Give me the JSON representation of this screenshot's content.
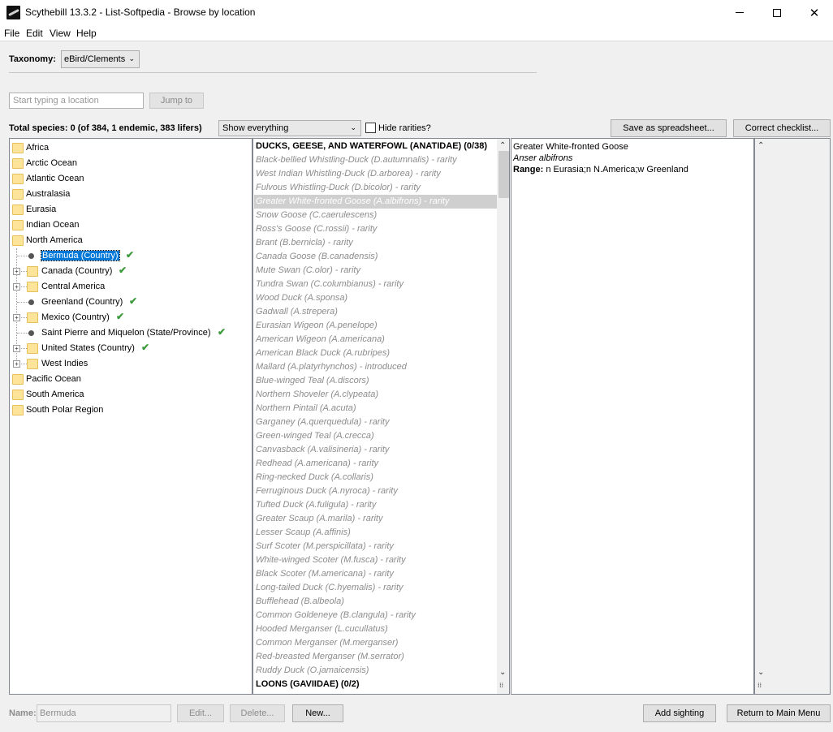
{
  "window": {
    "title": "Scythebill 13.3.2 - List-Softpedia - Browse by location",
    "icon": "scythebill-logo-icon",
    "minimize": "minimize",
    "maximize": "maximize",
    "close_glyph": "✕"
  },
  "menu": [
    "File",
    "Edit",
    "View",
    "Help"
  ],
  "taxonomy": {
    "label": "Taxonomy:",
    "value": "eBird/Clements"
  },
  "location_search": {
    "placeholder": "Start typing a location",
    "jump_label": "Jump to"
  },
  "totals": {
    "text": "Total species: 0 (of 384, 1 endemic, 383 lifers)",
    "filter_value": "Show everything",
    "hide_rarities_label": "Hide rarities?",
    "hide_rarities_checked": false,
    "save_label": "Save as spreadsheet...",
    "correct_label": "Correct checklist..."
  },
  "tree": {
    "top_level": [
      "Africa",
      "Arctic Ocean",
      "Atlantic Ocean",
      "Australasia",
      "Eurasia",
      "Indian Ocean",
      "North America",
      "Pacific Ocean",
      "South America",
      "South Polar Region"
    ],
    "north_america_children": [
      {
        "label": "Bermuda (Country)",
        "kind": "leaf",
        "checked": true,
        "selected": true
      },
      {
        "label": "Canada (Country)",
        "kind": "folder",
        "checked": true,
        "selected": false
      },
      {
        "label": "Central America",
        "kind": "folder",
        "checked": false,
        "selected": false
      },
      {
        "label": "Greenland (Country)",
        "kind": "leaf",
        "checked": true,
        "selected": false
      },
      {
        "label": "Mexico (Country)",
        "kind": "folder",
        "checked": true,
        "selected": false
      },
      {
        "label": "Saint Pierre and Miquelon (State/Province)",
        "kind": "leaf",
        "checked": true,
        "selected": false
      },
      {
        "label": "United States (Country)",
        "kind": "folder",
        "checked": true,
        "selected": false
      },
      {
        "label": "West Indies",
        "kind": "folder",
        "checked": false,
        "selected": false
      }
    ],
    "check_glyph": "✔",
    "expander_glyph": "+"
  },
  "species": {
    "family_1": "DUCKS, GEESE, AND WATERFOWL (ANATIDAE) (0/38)",
    "family_2": "LOONS (GAVIIDAE) (0/2)",
    "rows": [
      "Black-bellied Whistling-Duck (D.autumnalis) - rarity",
      "West Indian Whistling-Duck (D.arborea) - rarity",
      "Fulvous Whistling-Duck (D.bicolor) - rarity",
      "Greater White-fronted Goose (A.albifrons) - rarity",
      "Snow Goose (C.caerulescens)",
      "Ross's Goose (C.rossii) - rarity",
      "Brant (B.bernicla) - rarity",
      "Canada Goose (B.canadensis)",
      "Mute Swan (C.olor) - rarity",
      "Tundra Swan (C.columbianus) - rarity",
      "Wood Duck (A.sponsa)",
      "Gadwall (A.strepera)",
      "Eurasian Wigeon (A.penelope)",
      "American Wigeon (A.americana)",
      "American Black Duck (A.rubripes)",
      "Mallard (A.platyrhynchos) - introduced",
      "Blue-winged Teal (A.discors)",
      "Northern Shoveler (A.clypeata)",
      "Northern Pintail (A.acuta)",
      "Garganey (A.querquedula) - rarity",
      "Green-winged Teal (A.crecca)",
      "Canvasback (A.valisineria) - rarity",
      "Redhead (A.americana) - rarity",
      "Ring-necked Duck (A.collaris)",
      "Ferruginous Duck (A.nyroca) - rarity",
      "Tufted Duck (A.fuligula) - rarity",
      "Greater Scaup (A.marila) - rarity",
      "Lesser Scaup (A.affinis)",
      "Surf Scoter (M.perspicillata) - rarity",
      "White-winged Scoter (M.fusca) - rarity",
      "Black Scoter (M.americana) - rarity",
      "Long-tailed Duck (C.hyemalis) - rarity",
      "Bufflehead (B.albeola)",
      "Common Goldeneye (B.clangula) - rarity",
      "Hooded Merganser (L.cucullatus)",
      "Common Merganser (M.merganser)",
      "Red-breasted Merganser (M.serrator)",
      "Ruddy Duck (O.jamaicensis)"
    ],
    "selected_index": 3,
    "scroll_up": "⌃",
    "scroll_down": "⌄",
    "grip": "⁞⁞"
  },
  "detail": {
    "common_name": "Greater White-fronted Goose",
    "scientific_name": "Anser albifrons",
    "range_label": "Range:",
    "range_value": " n Eurasia;n N.America;w Greenland"
  },
  "bottom": {
    "name_label": "Name:",
    "name_value": "Bermuda",
    "edit_label": "Edit...",
    "delete_label": "Delete...",
    "new_label": "New...",
    "add_sighting_label": "Add sighting",
    "return_label": "Return to Main Menu"
  }
}
